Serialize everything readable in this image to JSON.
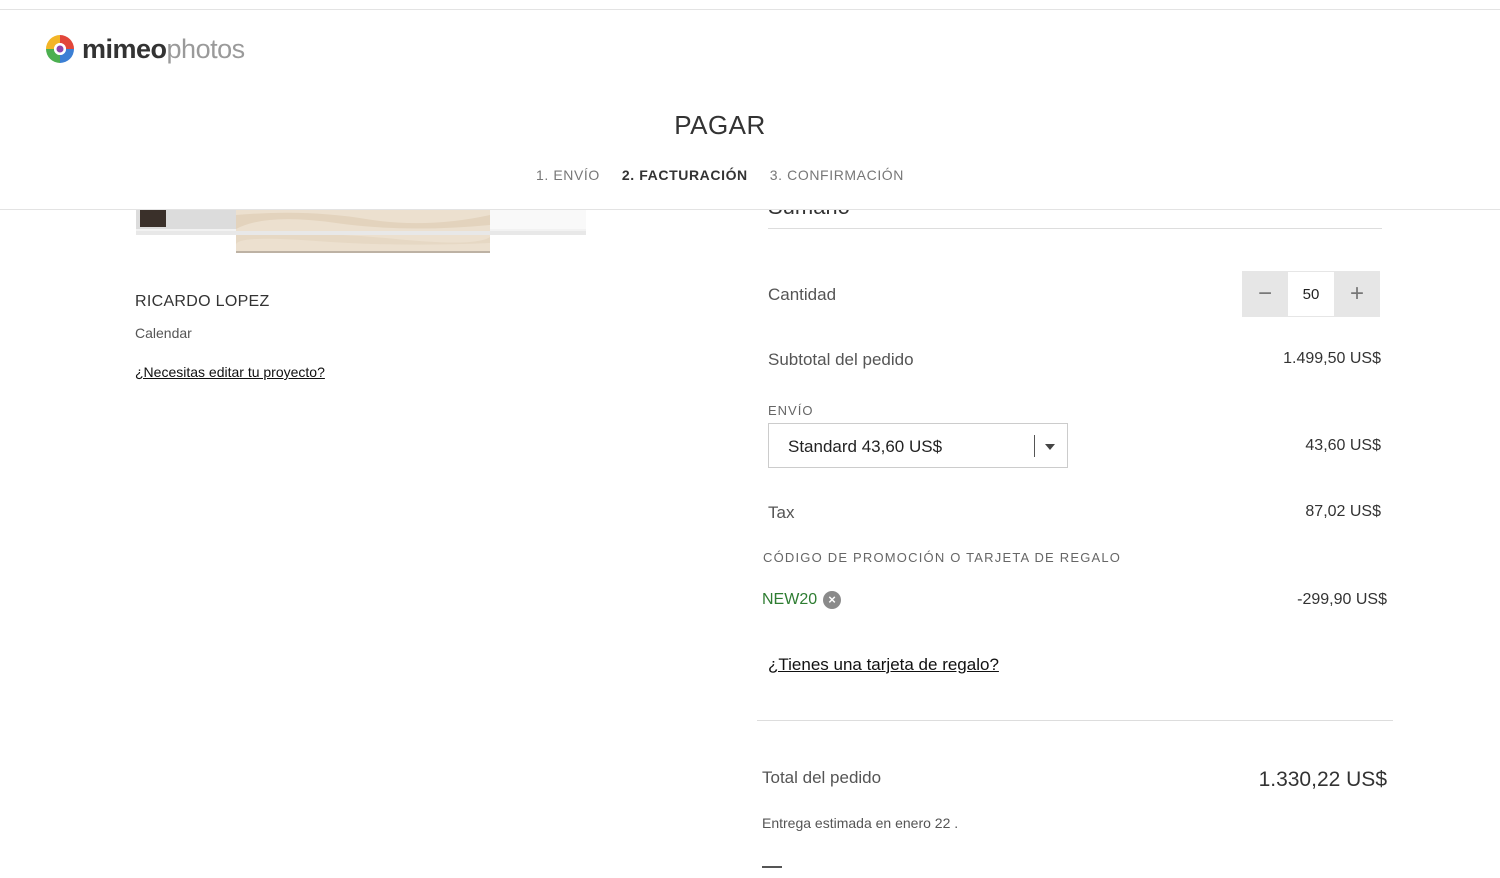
{
  "brand": {
    "name_bold": "mimeo",
    "name_light": "photos",
    "colors": {
      "red": "#e2463a",
      "yellow": "#f3b527",
      "green": "#4caf50",
      "blue": "#3b7fd4",
      "purple": "#8e44ad"
    }
  },
  "checkout": {
    "title": "PAGAR",
    "steps": [
      {
        "label": "1. ENVÍO",
        "active": false
      },
      {
        "label": "2. FACTURACIÓN",
        "active": true
      },
      {
        "label": "3. CONFIRMACIÓN",
        "active": false
      }
    ]
  },
  "project": {
    "customer_name": "RICARDO LOPEZ",
    "product_type": "Calendar",
    "edit_link": "¿Necesitas editar tu proyecto?"
  },
  "summary": {
    "heading": "Sumario",
    "quantity_label": "Cantidad",
    "quantity_value": "50",
    "decrement_symbol": "−",
    "increment_symbol": "+",
    "subtotal_label": "Subtotal del pedido",
    "subtotal_value": "1.499,50 US$",
    "shipping_label": "ENVÍO",
    "shipping_selected": "Standard 43,60 US$",
    "shipping_value": "43,60 US$",
    "tax_label": "Tax",
    "tax_value": "87,02 US$",
    "promo_label": "CÓDIGO DE PROMOCIÓN O TARJETA DE REGALO",
    "promo_code": "NEW20",
    "promo_value": "-299,90 US$",
    "gift_card_link": "¿Tienes una tarjeta de regalo?",
    "total_label": "Total del pedido",
    "total_value": "1.330,22 US$",
    "delivery_estimate": "Entrega estimada en enero 22 ."
  }
}
